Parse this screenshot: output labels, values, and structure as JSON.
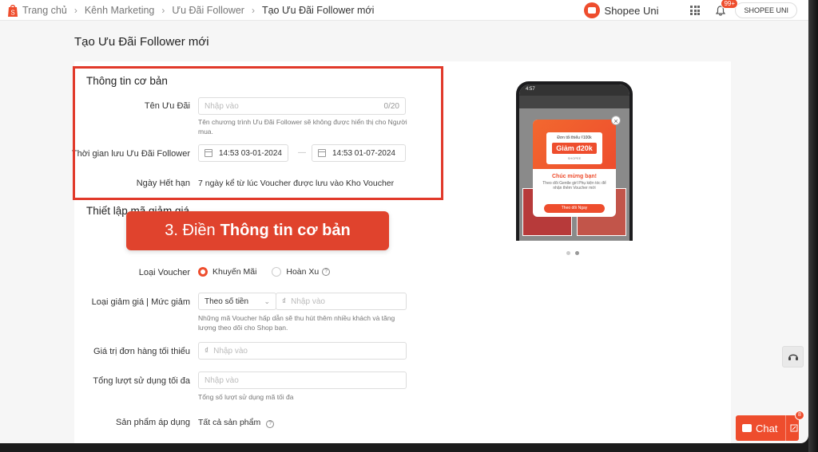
{
  "breadcrumb": {
    "items": [
      {
        "label": "Trang chủ"
      },
      {
        "label": "Kênh Marketing"
      },
      {
        "label": "Ưu Đãi Follower"
      },
      {
        "label": "Tạo Ưu Đãi Follower mới"
      }
    ]
  },
  "header": {
    "uni_label": "Shopee Uni",
    "notification_count": "99+",
    "user_label": "SHOPEE UNI"
  },
  "page_title": "Tạo Ưu Đãi Follower mới",
  "basic_info": {
    "section_title": "Thông tin cơ bản",
    "name_label": "Tên Ưu Đãi",
    "name_placeholder": "Nhập vào",
    "name_counter": "0/20",
    "name_hint": "Tên chương trình Ưu Đãi Follower sẽ không được hiển thị cho Người mua.",
    "period_label": "Thời gian lưu Ưu Đãi Follower",
    "start_date": "14:53 03-01-2024",
    "date_separator": "—",
    "end_date": "14:53 01-07-2024",
    "expiry_label": "Ngày Hết hạn",
    "expiry_value": "7 ngày kể từ lúc Voucher được lưu vào Kho Voucher"
  },
  "callout": {
    "prefix": "3. Điền",
    "emphasis": "Thông tin cơ bản"
  },
  "voucher_setup": {
    "section_title": "Thiết lập mã giảm giá",
    "type_label": "Loại Voucher",
    "type_options": [
      {
        "label": "Khuyến Mãi",
        "selected": true
      },
      {
        "label": "Hoàn Xu",
        "selected": false
      }
    ],
    "discount_label": "Loại giảm giá | Mức giảm",
    "discount_type": "Theo số tiền",
    "currency_symbol": "₫",
    "discount_placeholder": "Nhập vào",
    "discount_hint": "Những mã Voucher hấp dẫn sẽ thu hút thêm nhiều khách và tăng lượng theo dõi cho Shop bạn.",
    "min_order_label": "Giá trị đơn hàng tối thiểu",
    "min_order_placeholder": "Nhập vào",
    "max_usage_label": "Tổng lượt sử dụng tối đa",
    "max_usage_placeholder": "Nhập vào",
    "max_usage_hint": "Tổng số lượt sử dụng mã tối đa",
    "products_label": "Sản phẩm áp dụng",
    "products_value": "Tất cả sản phẩm"
  },
  "preview": {
    "status_time": "4:57",
    "voucher_min": "Đơn tối thiểu ₫100k",
    "voucher_amount": "Giảm đ20k",
    "voucher_shop": "SHOPEE",
    "popup_title": "Chúc mừng bạn!",
    "popup_text": "Theo dõi Gentle girl Phụ kiện tóc để nhận thêm Voucher mới",
    "popup_button": "Theo dõi Ngay",
    "close": "×"
  },
  "chat": {
    "label": "Chat",
    "badge": "8"
  },
  "colors": {
    "brand": "#ee4d2d",
    "highlight": "#e1392a"
  }
}
